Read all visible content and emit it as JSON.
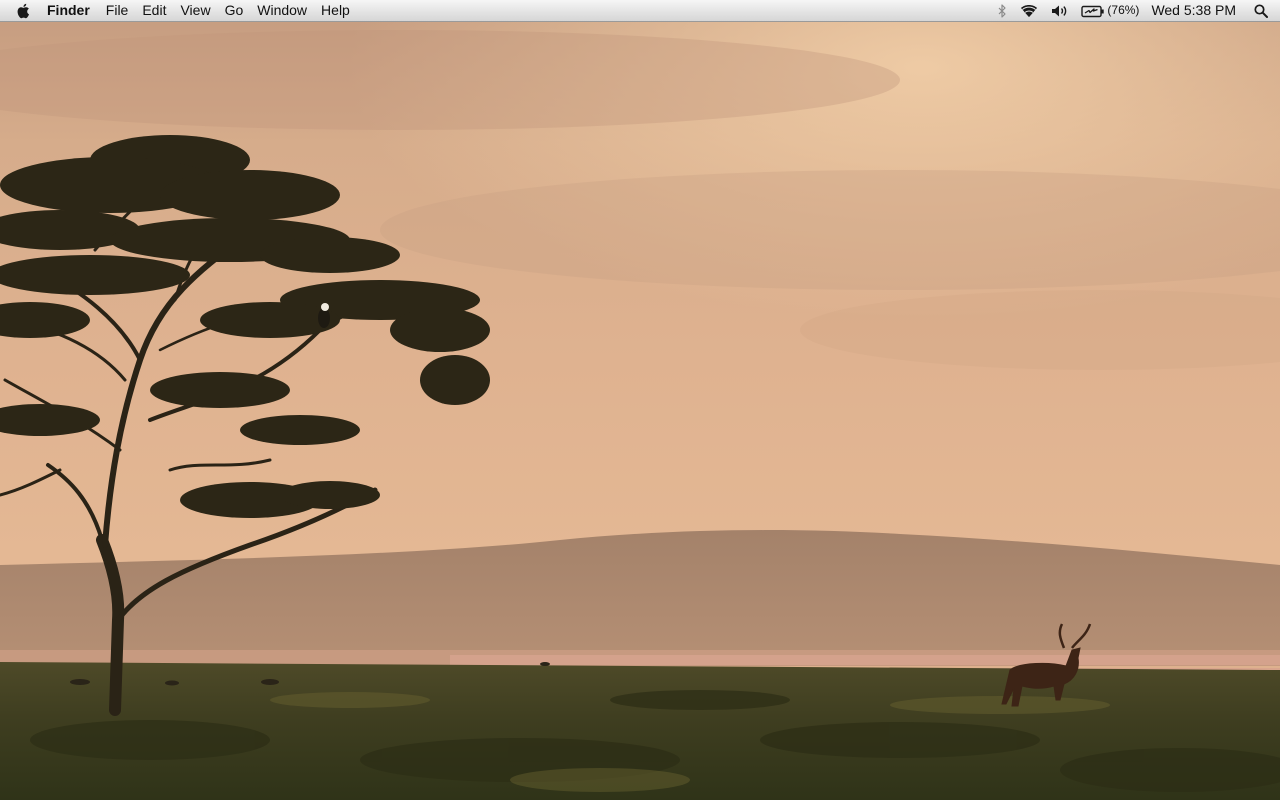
{
  "menubar": {
    "apple_icon": "apple-icon",
    "app_name": "Finder",
    "menus": [
      "File",
      "Edit",
      "View",
      "Go",
      "Window",
      "Help"
    ],
    "status": {
      "bluetooth_icon": "bluetooth-icon",
      "wifi_icon": "wifi-icon",
      "volume_icon": "volume-icon",
      "battery_icon": "battery-charging-icon",
      "battery_percent": "(76%)",
      "clock": "Wed 5:38 PM",
      "spotlight_icon": "spotlight-search-icon"
    }
  },
  "desktop": {
    "wallpaper": "African savanna sunset with acacia tree and impala",
    "colors": {
      "sky_top": "#c99e7f",
      "sky_mid": "#e3b894",
      "hill": "#a07f68",
      "water": "#d9a98f",
      "grass": "#3e3d20"
    }
  }
}
